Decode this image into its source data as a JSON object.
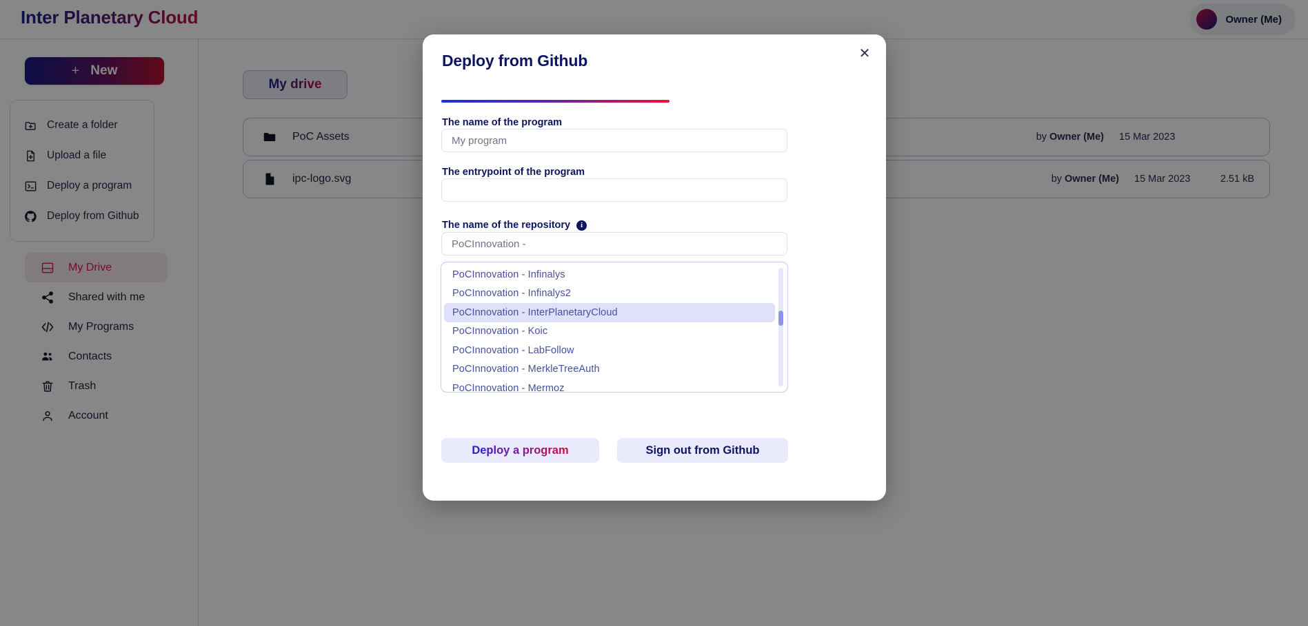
{
  "header": {
    "brand_title": "Inter Planetary Cloud",
    "owner_label": "Owner (Me)",
    "avatar_icon": "user-avatar-gradient"
  },
  "sidebar": {
    "new_button": {
      "label": "New",
      "plus_glyph": "+"
    },
    "quick_actions": [
      {
        "label": "Create a folder",
        "icon": "folder-plus-icon"
      },
      {
        "label": "Upload a file",
        "icon": "file-plus-icon"
      },
      {
        "label": "Deploy a program",
        "icon": "terminal-icon"
      },
      {
        "label": "Deploy from Github",
        "icon": "github-icon"
      }
    ],
    "nav_items": [
      {
        "label": "My Drive",
        "icon": "drive-icon",
        "active": true
      },
      {
        "label": "Shared with me",
        "icon": "share-icon",
        "active": false
      },
      {
        "label": "My Programs",
        "icon": "code-icon",
        "active": false
      },
      {
        "label": "Contacts",
        "icon": "contacts-icon",
        "active": false
      },
      {
        "label": "Trash",
        "icon": "trash-icon",
        "active": false
      },
      {
        "label": "Account",
        "icon": "person-icon",
        "active": false
      }
    ]
  },
  "main": {
    "breadcrumb_label": "My drive",
    "file_rows": [
      {
        "name": "PoC Assets",
        "icon": "folder-icon",
        "owner_prefix": "by",
        "owner": "Owner (Me)",
        "date": "15 Mar 2023",
        "size": ""
      },
      {
        "name": "ipc-logo.svg",
        "icon": "file-icon",
        "owner_prefix": "by",
        "owner": "Owner (Me)",
        "date": "15 Mar 2023",
        "size": "2.51 kB"
      }
    ]
  },
  "modal": {
    "title": "Deploy from Github",
    "close_icon": "close-icon",
    "close_glyph": "✕",
    "fields": {
      "program_name": {
        "label": "The name of the program",
        "value": "",
        "placeholder": "My program"
      },
      "entrypoint": {
        "label": "The entrypoint of the program",
        "value": "",
        "placeholder": ""
      },
      "repository": {
        "label": "The name of the repository",
        "info_icon": "info-icon",
        "info_glyph": "i",
        "value": "PoCInnovation - ",
        "placeholder": "PoCInnovation - "
      }
    },
    "dropdown": {
      "options": [
        {
          "label": "PoCInnovation - Infinalys",
          "selected": false
        },
        {
          "label": "PoCInnovation - Infinalys2",
          "selected": false
        },
        {
          "label": "PoCInnovation - InterPlanetaryCloud",
          "selected": true
        },
        {
          "label": "PoCInnovation - Koic",
          "selected": false
        },
        {
          "label": "PoCInnovation - LabFollow",
          "selected": false
        },
        {
          "label": "PoCInnovation - MerkleTreeAuth",
          "selected": false
        },
        {
          "label": "PoCInnovation - Mermoz",
          "selected": false
        }
      ],
      "scrollbar_icon": "vertical-scrollbar"
    },
    "buttons": {
      "deploy": "Deploy a program",
      "signout": "Sign out from Github"
    }
  },
  "colors": {
    "brand_blue": "#1a1f8f",
    "brand_crimson": "#c4123f",
    "navy_text": "#0d1560",
    "accent_red": "#d81b4b",
    "dropdown_highlight": "#dfe1fa",
    "button_bg": "#e9eafc",
    "overlay": "rgba(0,0,0,0.47)"
  }
}
